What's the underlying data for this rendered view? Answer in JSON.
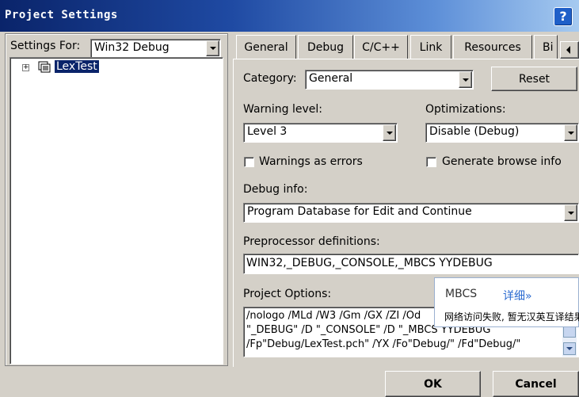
{
  "window": {
    "title": "Project Settings",
    "help_label": "?"
  },
  "settings_for": {
    "label": "Settings For:",
    "selected": "Win32 Debug"
  },
  "tree": {
    "items": [
      {
        "label": "LexTest",
        "expander": "+",
        "icon": "project-icon"
      }
    ]
  },
  "tabs": [
    {
      "label": "General"
    },
    {
      "label": "Debug"
    },
    {
      "label": "C/C++"
    },
    {
      "label": "Link"
    },
    {
      "label": "Resources"
    },
    {
      "label": "Bi"
    }
  ],
  "panel": {
    "category_label": "Category:",
    "category_value": "General",
    "reset_label": "Reset",
    "warning_level_label": "Warning level:",
    "warning_level_value": "Level 3",
    "optimizations_label": "Optimizations:",
    "optimizations_value": "Disable (Debug)",
    "warnings_as_errors_label": "Warnings as errors",
    "generate_browse_label": "Generate browse info",
    "debug_info_label": "Debug info:",
    "debug_info_value": "Program Database for Edit and Continue",
    "preprocessor_label": "Preprocessor definitions:",
    "preprocessor_value": "WIN32,_DEBUG,_CONSOLE,_MBCS YYDEBUG",
    "project_options_label": "Project Options:",
    "project_options_lines": [
      "/nologo /MLd /W3 /Gm /GX /ZI /Od",
      "\"_DEBUG\" /D \"_CONSOLE\" /D \"_MBCS YYDEBUG",
      "/Fp\"Debug/LexTest.pch\" /YX /Fo\"Debug/\" /Fd\"Debug/\""
    ]
  },
  "popup": {
    "term": "MBCS",
    "detail_link": "详细»",
    "message": "网络访问失败, 暂无汉英互译结果"
  },
  "buttons": {
    "ok": "OK",
    "cancel": "Cancel"
  }
}
